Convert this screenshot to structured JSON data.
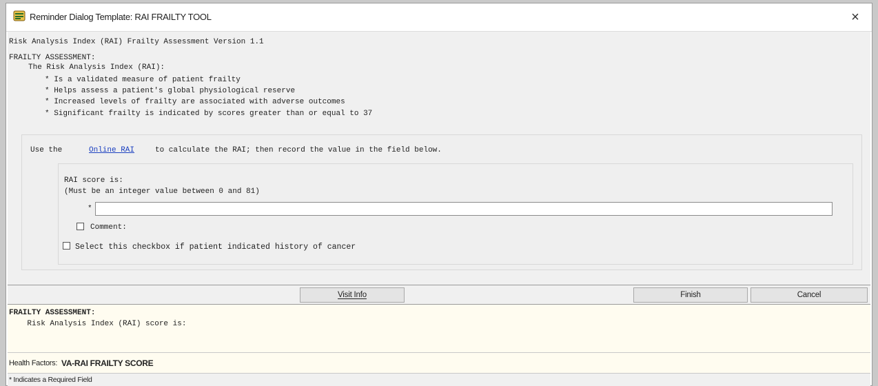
{
  "window": {
    "title": "Reminder Dialog Template: RAI FRAILTY TOOL",
    "close_label": "×"
  },
  "content": {
    "header": "Risk Analysis Index (RAI) Frailty Assessment Version 1.1",
    "section_title": "FRAILTY ASSESSMENT:",
    "intro": "The Risk Analysis Index (RAI):",
    "bullets": [
      "* Is a validated measure of patient frailty",
      "* Helps assess a patient's global physiological reserve",
      "* Increased levels of frailty are associated with adverse outcomes",
      "* Significant frailty is indicated by scores greater than or equal to 37"
    ],
    "instruction_prefix": "Use the",
    "instruction_link": "Online RAI",
    "instruction_suffix": "to calculate the RAI; then record the value in the field below.",
    "score_label": "RAI score is:",
    "score_hint": "(Must be an integer value between 0 and 81)",
    "required_marker": "*",
    "score_value": "",
    "comment_label": "Comment:",
    "comment_checked": false,
    "cancer_label": "Select this checkbox if patient indicated history of cancer",
    "cancer_checked": false
  },
  "buttons": {
    "visit_info": "Visit Info",
    "finish": "Finish",
    "cancel": "Cancel"
  },
  "preview": {
    "line1": "FRAILTY ASSESSMENT:",
    "line2": "    Risk Analysis Index (RAI) score is:"
  },
  "health_factors": {
    "label": "Health Factors:",
    "value": "VA-RAI FRAILTY SCORE"
  },
  "status": {
    "text": "* Indicates a Required Field"
  },
  "icons": {
    "title_icon": "reminder-template-icon",
    "close_icon": "close-icon"
  },
  "colors": {
    "link": "#1a3fc0",
    "preview_bg": "#fffcf0",
    "panel_bg": "#f0f0f0"
  }
}
